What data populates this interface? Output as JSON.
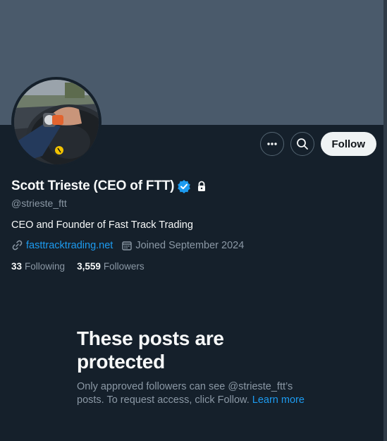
{
  "profile": {
    "display_name": "Scott Trieste (CEO of FTT)",
    "handle": "@strieste_ftt",
    "bio": "CEO and Founder of Fast Track Trading",
    "website": "fasttracktrading.net",
    "joined": "Joined September 2024",
    "following_count": "33",
    "following_label": "Following",
    "followers_count": "3,559",
    "followers_label": "Followers",
    "verified": true,
    "protected": true
  },
  "actions": {
    "more_icon": "more-horizontal-icon",
    "search_icon": "search-icon",
    "follow_label": "Follow"
  },
  "protected_notice": {
    "title": "These posts are protected",
    "body": "Only approved followers can see @strieste_ftt’s posts. To request access, click Follow.",
    "learn_more": "Learn more"
  },
  "colors": {
    "background": "#15202b",
    "banner": "#4a5a6b",
    "accent": "#1d9bf0",
    "secondary_text": "#8b98a5"
  }
}
